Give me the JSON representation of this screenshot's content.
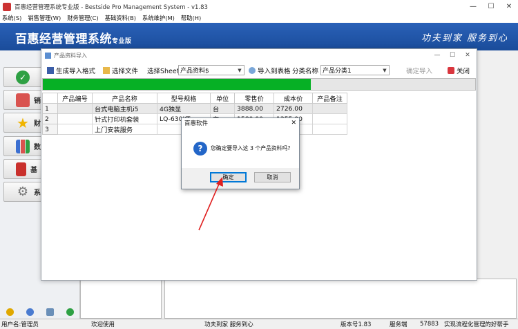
{
  "window": {
    "title": "百惠经营管理系统专业版 - Bestside Pro Management System - v1.83",
    "minimize": "—",
    "maximize": "☐",
    "close": "✕"
  },
  "menu": [
    "系统(S)",
    "销售管理(W)",
    "财务管理(C)",
    "基础资料(B)",
    "系统维护(M)",
    "帮助(H)"
  ],
  "banner": {
    "brand": "百惠经营管理系统",
    "edition": "专业版",
    "slogan": "功夫到家 服务到心"
  },
  "sidebar": {
    "items": [
      {
        "label": "",
        "icon": "check-icon",
        "color": "#2ea043"
      },
      {
        "label": "销",
        "icon": "house-icon",
        "color": "#d9534f"
      },
      {
        "label": "财",
        "icon": "star-icon",
        "color": "#f0b400"
      },
      {
        "label": "数",
        "icon": "bar-chart-icon",
        "color": "#3b6fd1"
      },
      {
        "label": "基",
        "icon": "book-icon",
        "color": "#c9302c"
      },
      {
        "label": "系",
        "icon": "gear-icon",
        "color": "#777777"
      }
    ],
    "bottom_icons": [
      "help-icon",
      "info-icon",
      "search-icon",
      "plus-icon"
    ]
  },
  "import_window": {
    "title": "产品资料导入",
    "toolbar": {
      "gen_format": "生成导入格式",
      "choose_file": "选择文件",
      "sheet_label": "选择Sheet",
      "sheet_value": "产品资料$",
      "import_to_table": "导入到表格",
      "category_label": "分类名称",
      "category_value": "产品分类1",
      "confirm_import": "确定导入",
      "close": "关闭"
    },
    "progress": 0.62,
    "columns": [
      "",
      "产品编号",
      "产品名称",
      "型号规格",
      "单位",
      "零售价",
      "成本价",
      "产品备注"
    ],
    "rows": [
      [
        "1",
        "",
        "台式电脑主机i5",
        "4G独显",
        "台",
        "3888.00",
        "2726.00",
        ""
      ],
      [
        "2",
        "",
        "针式打印机套装",
        "LQ-630KT",
        "套",
        "1580.00",
        "1355.00",
        ""
      ],
      [
        "3",
        "",
        "上门安装服务",
        "",
        "",
        "",
        "",
        ""
      ]
    ]
  },
  "confirm_dialog": {
    "title": "百惠软件",
    "message": "您确定要导入这 3 个产品资料吗?",
    "ok": "确定",
    "cancel": "取消"
  },
  "statusbar": {
    "user": "用户名:管理员",
    "welcome": "欢迎使用",
    "slogan": "功夫到家 服务到心",
    "version": "版本号1.83",
    "service_label": "服务端",
    "service_value": "57883",
    "tagline": "实现流程化管理的好帮手"
  }
}
